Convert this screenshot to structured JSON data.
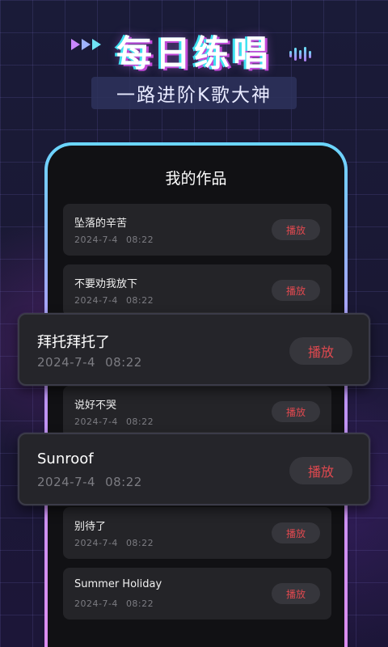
{
  "header": {
    "title": "每日练唱",
    "subtitle": "一路进阶K歌大神",
    "left_icon": "triple-chevron-right-icon",
    "right_icon": "sound-wave-icon"
  },
  "phone": {
    "title": "我的作品",
    "play_label": "播放",
    "songs": [
      {
        "name": "坠落的辛苦",
        "date": "2024-7-4",
        "time": "08:22"
      },
      {
        "name": "不要劝我放下",
        "date": "2024-7-4",
        "time": "08:22"
      },
      {
        "name": "拜托拜托了",
        "date": "2024-7-4",
        "time": "08:22"
      },
      {
        "name": "说好不哭",
        "date": "2024-7-4",
        "time": "08:22"
      },
      {
        "name": "Sunroof",
        "date": "2024-7-4",
        "time": "08:22"
      },
      {
        "name": "别待了",
        "date": "2024-7-4",
        "time": "08:22"
      },
      {
        "name": "Summer Holiday",
        "date": "2024-7-4",
        "time": "08:22"
      }
    ]
  },
  "colors": {
    "accent_play": "#e0494f",
    "frame_gradient_top": "#6ad6ff",
    "frame_gradient_bottom": "#e08cf0"
  }
}
